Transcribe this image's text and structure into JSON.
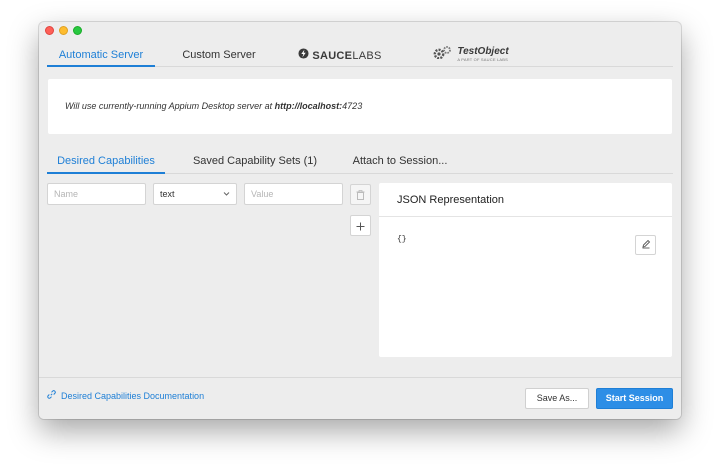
{
  "server_tabs": [
    {
      "label": "Automatic Server",
      "active": true
    },
    {
      "label": "Custom Server",
      "active": false
    },
    {
      "label_bold": "SAUCE",
      "label_thin": "LABS",
      "icon": "saucelabs-bolt-icon"
    },
    {
      "label": "TestObject",
      "sublabel": "A PART OF SAUCE LABS",
      "icon": "testobject-gear-icon"
    }
  ],
  "info": {
    "prefix": "Will use currently-running Appium Desktop server at ",
    "url_bold": "http://localhost:",
    "port": "4723"
  },
  "cap_tabs": [
    {
      "label": "Desired Capabilities",
      "active": true
    },
    {
      "label": "Saved Capability Sets (1)",
      "active": false
    },
    {
      "label": "Attach to Session...",
      "active": false
    }
  ],
  "capability": {
    "name_placeholder": "Name",
    "type_value": "text",
    "value_placeholder": "Value"
  },
  "json_panel": {
    "title": "JSON Representation",
    "content": "{}"
  },
  "footer": {
    "doc_link": "Desired Capabilities Documentation",
    "save_as": "Save As...",
    "start_session": "Start Session"
  },
  "colors": {
    "accent": "#1e7fd6",
    "primary_button": "#2d8ee6"
  }
}
